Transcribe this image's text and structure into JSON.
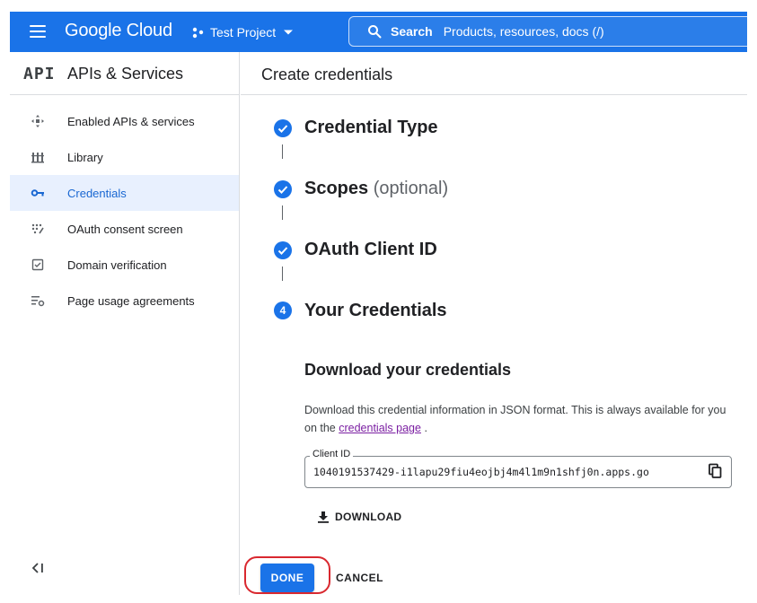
{
  "topbar": {
    "brand": "Google Cloud",
    "project_name": "Test Project",
    "search_label": "Search",
    "search_placeholder": "Products, resources, docs (/)",
    "accent_color": "#1a73e8"
  },
  "sidebar": {
    "badge": "API",
    "title": "APIs & Services",
    "items": [
      {
        "label": "Enabled APIs & services",
        "icon": "enabled-apis-icon",
        "active": false
      },
      {
        "label": "Library",
        "icon": "library-icon",
        "active": false
      },
      {
        "label": "Credentials",
        "icon": "key-icon",
        "active": true
      },
      {
        "label": "OAuth consent screen",
        "icon": "oauth-consent-icon",
        "active": false
      },
      {
        "label": "Domain verification",
        "icon": "checkbox-icon",
        "active": false
      },
      {
        "label": "Page usage agreements",
        "icon": "settings-list-icon",
        "active": false
      }
    ],
    "collapse_icon": "collapse-sidebar-icon"
  },
  "main": {
    "page_title": "Create credentials",
    "steps": [
      {
        "title": "Credential Type",
        "status": "complete"
      },
      {
        "title": "Scopes",
        "optional": "(optional)",
        "status": "complete"
      },
      {
        "title": "OAuth Client ID",
        "status": "complete"
      },
      {
        "title": "Your Credentials",
        "number": "4",
        "status": "current"
      }
    ],
    "download": {
      "title": "Download your credentials",
      "desc_before": "Download this credential information in JSON format. This is always available for you on the ",
      "desc_link": "credentials page",
      "desc_after": " .",
      "client_id_label": "Client ID",
      "client_id_value": "1040191537429-i1lapu29fiu4eojbj4m4l1m9n1shfj0n.apps.go",
      "download_label": "DOWNLOAD"
    },
    "actions": {
      "done_label": "DONE",
      "cancel_label": "CANCEL",
      "highlight_color": "#d9282f"
    }
  }
}
